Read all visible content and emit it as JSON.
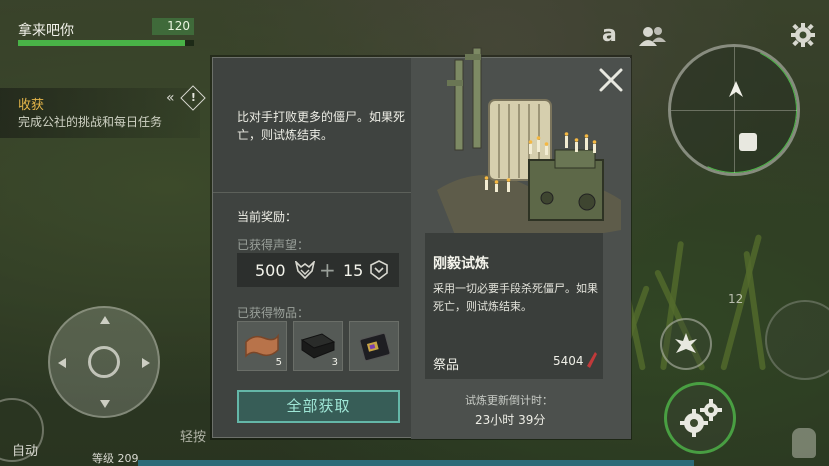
{
  "hud": {
    "player_name": "拿来吧你",
    "player_hp": "120",
    "player_hp_fraction": 0.95,
    "quest_title": "收获",
    "quest_desc": "完成公社的挑战和每日任务",
    "quest_arrows": "«",
    "quest_alert": "!",
    "top_icons": [
      "a-icon",
      "people-icon",
      "gear-icon"
    ],
    "top_a_glyph": "a",
    "auto_label": "自动",
    "level_label": "等级 209",
    "hint_text": "轻按",
    "right_level": "12"
  },
  "dialog": {
    "description": "比对手打败更多的僵尸。如果死亡，则试炼结束。",
    "reward_label": "当前奖励：",
    "reputation_label": "已获得声望：",
    "reputation_value_1": "500",
    "reputation_plus": "+",
    "reputation_value_2": "15",
    "items_label": "已获得物品：",
    "items": [
      {
        "icon": "leather-icon",
        "count": "5"
      },
      {
        "icon": "cloth-icon",
        "count": "3"
      },
      {
        "icon": "chip-device-icon",
        "count": ""
      }
    ],
    "get_all_button": "全部获取",
    "trial_title": "刚毅试炼",
    "trial_desc": "采用一切必要手段杀死僵尸。如果死亡，则试炼结束。",
    "offering_label": "祭品",
    "offering_value": "5404",
    "countdown_label": "试炼更新倒计时：",
    "countdown_value": "23小时 39分"
  },
  "colors": {
    "accent_teal": "#64b7a8",
    "hp_green": "#49b347",
    "quest_gold": "#e5b64a",
    "dialog_bg": "#3f4340"
  }
}
